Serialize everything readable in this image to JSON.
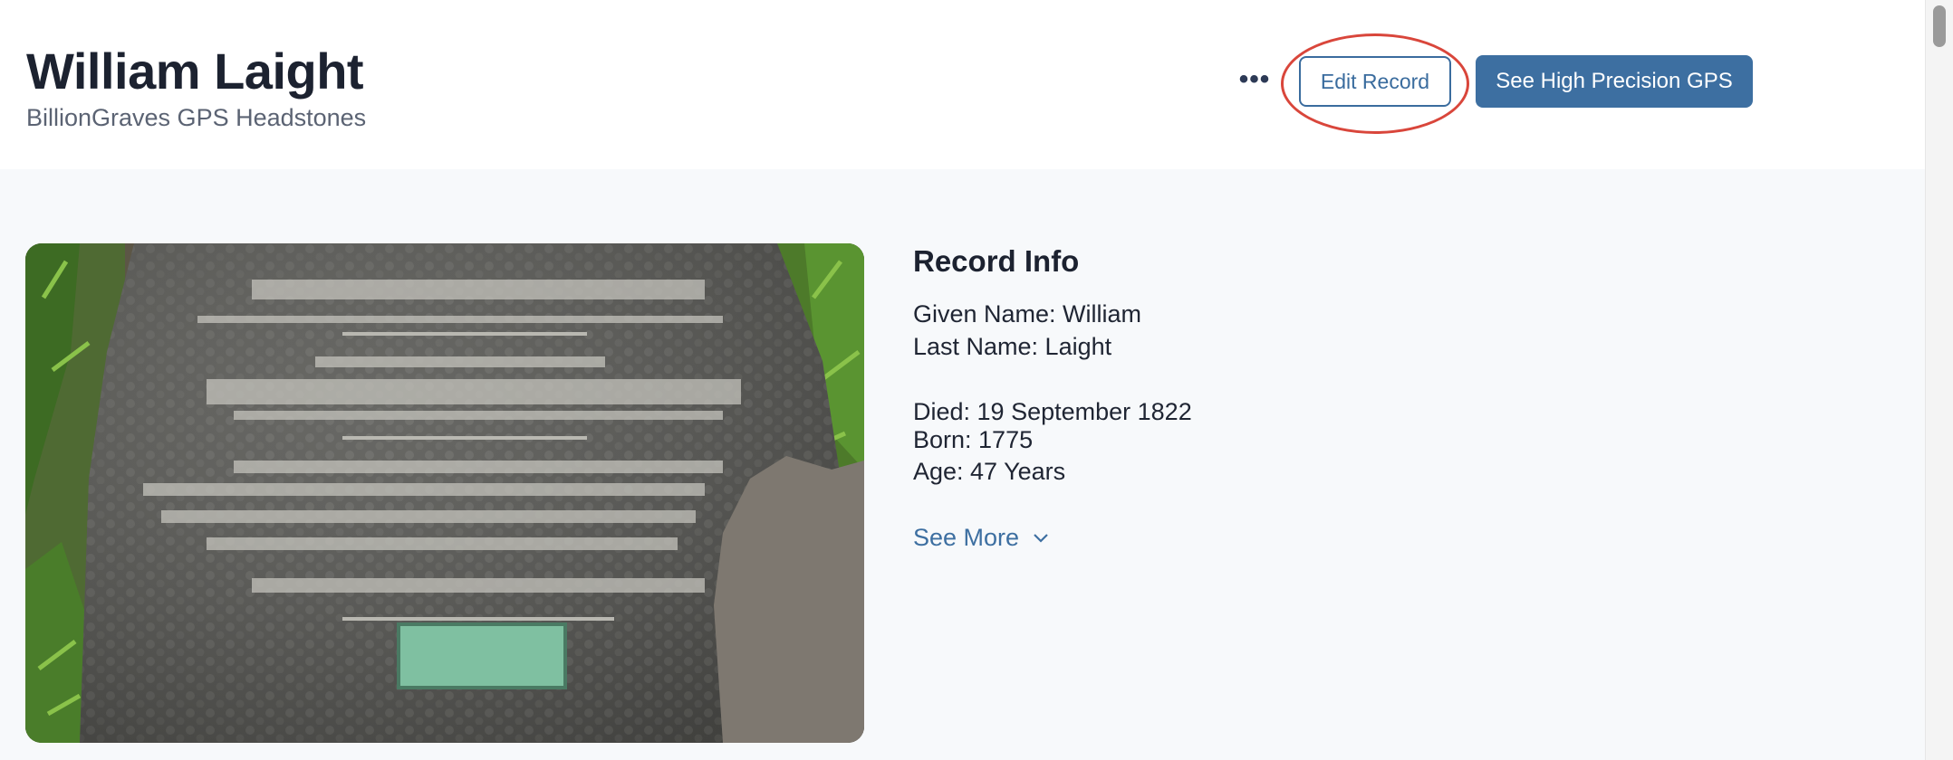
{
  "header": {
    "title": "William Laight",
    "subtitle": "BillionGraves GPS Headstones",
    "more_label": "•••",
    "edit_label": "Edit Record",
    "gps_label": "See High Precision GPS"
  },
  "photo": {
    "alt": "Headstone of William Laight"
  },
  "record_info": {
    "heading": "Record Info",
    "given_name": "Given Name: William",
    "last_name": "Last Name: Laight",
    "died": "Died: 19 September 1822",
    "born": "Born: 1775",
    "age": "Age: 47 Years",
    "see_more_label": "See More"
  },
  "colors": {
    "accent": "#3d6fa1",
    "highlight": "#d9463b",
    "background": "#f7f9fb"
  }
}
